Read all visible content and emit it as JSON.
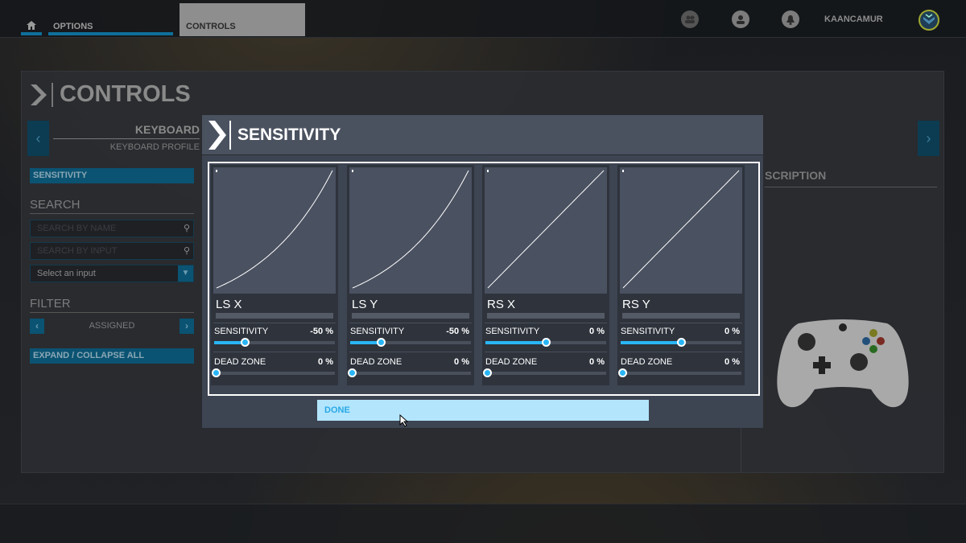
{
  "topbar": {
    "options_label": "OPTIONS",
    "controls_tab": "CONTROLS",
    "username": "KAANCAMUR"
  },
  "page": {
    "title": "CONTROLS"
  },
  "profile": {
    "device": "KEYBOARD",
    "profile": "KEYBOARD PROFILE"
  },
  "sidebar": {
    "sensitivity_button": "SENSITIVITY",
    "search_heading": "SEARCH",
    "search_name_placeholder": "SEARCH BY NAME",
    "search_input_placeholder": "SEARCH BY INPUT",
    "select_input": "Select an input",
    "filter_heading": "FILTER",
    "filter_value": "ASSIGNED",
    "expand_collapse": "EXPAND / COLLAPSE ALL"
  },
  "right": {
    "description_heading": "SCRIPTION"
  },
  "modal": {
    "title": "SENSITIVITY",
    "sensitivity_label": "SENSITIVITY",
    "deadzone_label": "DEAD ZONE",
    "axes": [
      {
        "name": "LS X",
        "sensitivity": -50,
        "sensitivity_text": "-50 %",
        "deadzone": 0,
        "deadzone_text": "0 %"
      },
      {
        "name": "LS Y",
        "sensitivity": -50,
        "sensitivity_text": "-50 %",
        "deadzone": 0,
        "deadzone_text": "0 %"
      },
      {
        "name": "RS X",
        "sensitivity": 0,
        "sensitivity_text": "0 %",
        "deadzone": 0,
        "deadzone_text": "0 %"
      },
      {
        "name": "RS Y",
        "sensitivity": 0,
        "sensitivity_text": "0 %",
        "deadzone": 0,
        "deadzone_text": "0 %"
      }
    ],
    "done_label": "DONE"
  },
  "colors": {
    "accent": "#29b6f6",
    "done_bg": "#b3e5fc",
    "modal_header": "#4a5260"
  }
}
